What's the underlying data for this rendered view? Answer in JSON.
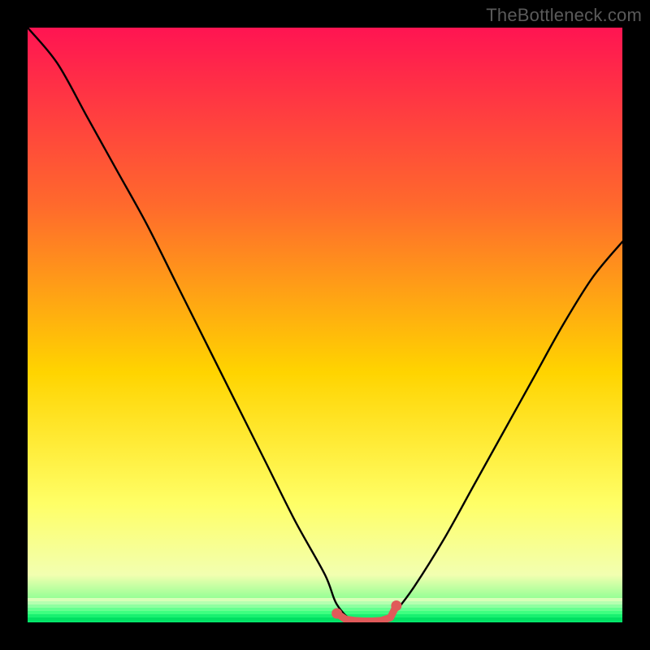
{
  "credit": "TheBottleneck.com",
  "colors": {
    "black": "#000000",
    "curve": "#000000",
    "marker": "#e05a5a",
    "grad_top": "#ff1452",
    "grad_mid1": "#ff6a2c",
    "grad_mid2": "#ffd400",
    "grad_low1": "#ffff66",
    "grad_low2": "#f2ffb0",
    "grad_green1": "#7dff8e",
    "grad_green2": "#00e56a"
  },
  "chart_data": {
    "type": "line",
    "title": "",
    "xlabel": "",
    "ylabel": "",
    "xlim": [
      0,
      100
    ],
    "ylim": [
      0,
      100
    ],
    "x": [
      0,
      5,
      10,
      15,
      20,
      25,
      30,
      35,
      40,
      45,
      50,
      52,
      55,
      58,
      60,
      62,
      65,
      70,
      75,
      80,
      85,
      90,
      95,
      100
    ],
    "values": [
      100,
      94,
      85,
      76,
      67,
      57,
      47,
      37,
      27,
      17,
      8,
      3,
      0,
      0,
      0,
      2,
      6,
      14,
      23,
      32,
      41,
      50,
      58,
      64
    ],
    "flat_region_x": [
      52,
      62
    ],
    "flat_region_y": 0,
    "markers_x": [
      52,
      53.5,
      55,
      56.5,
      58,
      59.5,
      61,
      62
    ],
    "markers_y": [
      1.5,
      0.5,
      0.3,
      0.2,
      0.2,
      0.3,
      0.8,
      2.8
    ],
    "annotations": []
  }
}
